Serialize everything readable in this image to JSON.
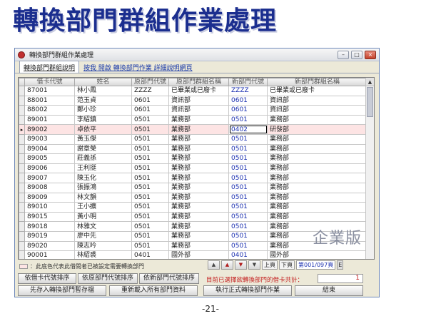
{
  "page": {
    "title": "轉換部門群組作業處理",
    "watermark": "企業版",
    "page_number": "-21-"
  },
  "window": {
    "title": "轉換部門群組作業處理",
    "controls": {
      "minimize": "–",
      "maximize": "□",
      "close": "×"
    }
  },
  "tabs": {
    "active": "轉換部門群組說明",
    "link": "按我 開啟 轉換部門作業 詳細說明網頁"
  },
  "grid": {
    "headers": [
      "借卡代號",
      "姓名",
      "原部門代號",
      "原部門群組名稱",
      "新部門代號",
      "新部門群組名稱"
    ],
    "rows": [
      [
        "87001",
        "林小鳳",
        "ZZZZ",
        "已畢業或已廢卡",
        "ZZZZ",
        "已畢業或已廢卡"
      ],
      [
        "88001",
        "范玉貞",
        "0601",
        "資訊部",
        "0601",
        "資訊部"
      ],
      [
        "88002",
        "鄭小珍",
        "0601",
        "資訊部",
        "0601",
        "資訊部"
      ],
      [
        "89001",
        "李紹鎮",
        "0501",
        "業務部",
        "0501",
        "業務部"
      ],
      [
        "89002",
        "卓依平",
        "0501",
        "業務部",
        "0402",
        "研發部"
      ],
      [
        "89003",
        "黃玉傑",
        "0501",
        "業務部",
        "0501",
        "業務部"
      ],
      [
        "89004",
        "謝章榮",
        "0501",
        "業務部",
        "0501",
        "業務部"
      ],
      [
        "89005",
        "莊義孫",
        "0501",
        "業務部",
        "0501",
        "業務部"
      ],
      [
        "89006",
        "王利挺",
        "0501",
        "業務部",
        "0501",
        "業務部"
      ],
      [
        "89007",
        "陳玉化",
        "0501",
        "業務部",
        "0501",
        "業務部"
      ],
      [
        "89008",
        "張振鴻",
        "0501",
        "業務部",
        "0501",
        "業務部"
      ],
      [
        "89009",
        "林文韻",
        "0501",
        "業務部",
        "0501",
        "業務部"
      ],
      [
        "89010",
        "王小擴",
        "0501",
        "業務部",
        "0501",
        "業務部"
      ],
      [
        "89015",
        "黃小明",
        "0501",
        "業務部",
        "0501",
        "業務部"
      ],
      [
        "89018",
        "林雅文",
        "0501",
        "業務部",
        "0501",
        "業務部"
      ],
      [
        "89019",
        "廖中先",
        "0501",
        "業務部",
        "0501",
        "業務部"
      ],
      [
        "89020",
        "陳志吟",
        "0501",
        "業務部",
        "0501",
        "業務部"
      ],
      [
        "90001",
        "林紹裘",
        "0401",
        "國外部",
        "0401",
        "國外部"
      ]
    ],
    "selected_row": 4,
    "row_indicator": "▸"
  },
  "legend": {
    "text": "：此底色代表此借閱者已被設定需要轉換部門"
  },
  "pager": {
    "prev_page": "上頁",
    "next_page": "下頁",
    "page_info": "第001/097頁",
    "end_marker": "E"
  },
  "buttons": {
    "sort_card": "依借卡代號排序",
    "sort_orig_dept": "依原部門代號排序",
    "sort_new_dept": "依新部門代號排序",
    "save_temp": "先存入轉換部門暫存檔",
    "reload_all": "重新載入所有部門資料",
    "execute": "執行正式轉換部門作業",
    "finish": "結束"
  },
  "count": {
    "label": "目前已選擇欲轉換部門的借卡共計：",
    "value": "1"
  },
  "colors": {
    "title": "#1b2e8f",
    "selected_row": "#fde4e4",
    "highlight_text": "#c42020",
    "new_code_text": "#1a2fb0"
  }
}
